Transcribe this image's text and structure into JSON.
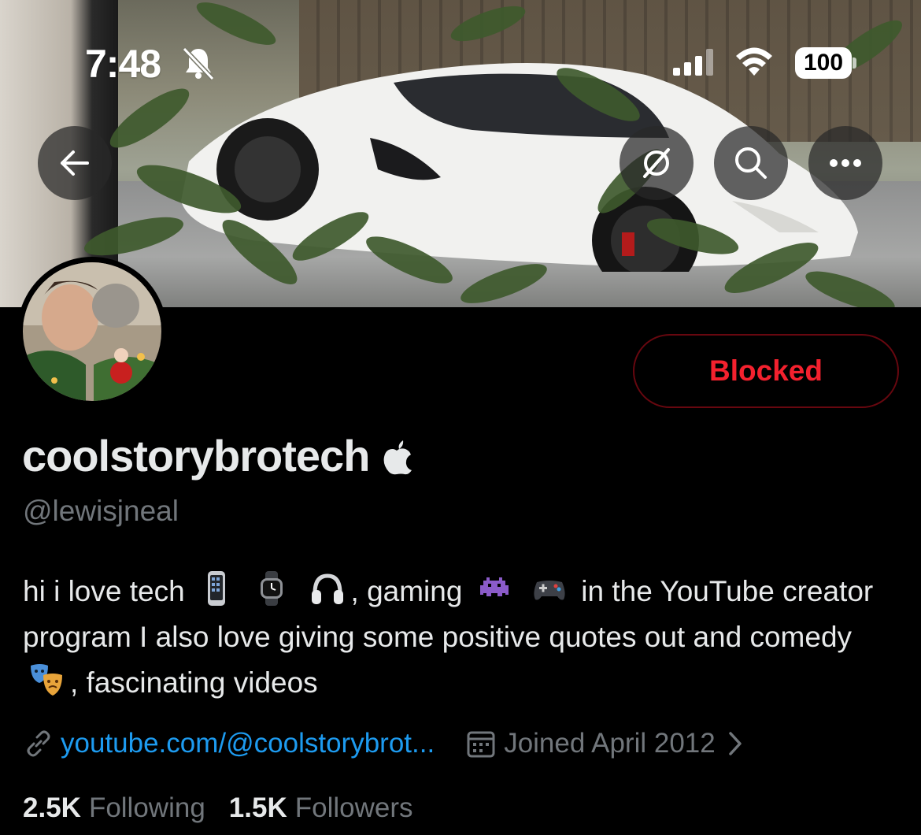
{
  "status_bar": {
    "time": "7:48",
    "battery": "100"
  },
  "profile": {
    "display_name": "coolstorybrotech",
    "handle": "@lewisjneal",
    "bio_segments": {
      "s1": "hi i love tech",
      "s2": ", gaming",
      "s3": "in the YouTube creator program I also love giving some positive quotes out and comedy",
      "s4": ", fascinating videos"
    },
    "website": "youtube.com/@coolstorybrot...",
    "joined": "Joined April 2012",
    "following_count": "2.5K",
    "following_label": "Following",
    "followers_count": "1.5K",
    "followers_label": "Followers",
    "blocked_label": "Blocked"
  },
  "icons": {
    "back": "arrow-left-icon",
    "hide_retweets": "retweet-off-icon",
    "search": "search-icon",
    "more": "more-horizontal-icon",
    "verified_badge": "apple-logo-icon"
  },
  "colors": {
    "accent": "#1d9bf0",
    "blocked": "#f4212e",
    "secondary_text": "#71767b",
    "primary_text": "#e7e9ea",
    "background": "#000000"
  }
}
